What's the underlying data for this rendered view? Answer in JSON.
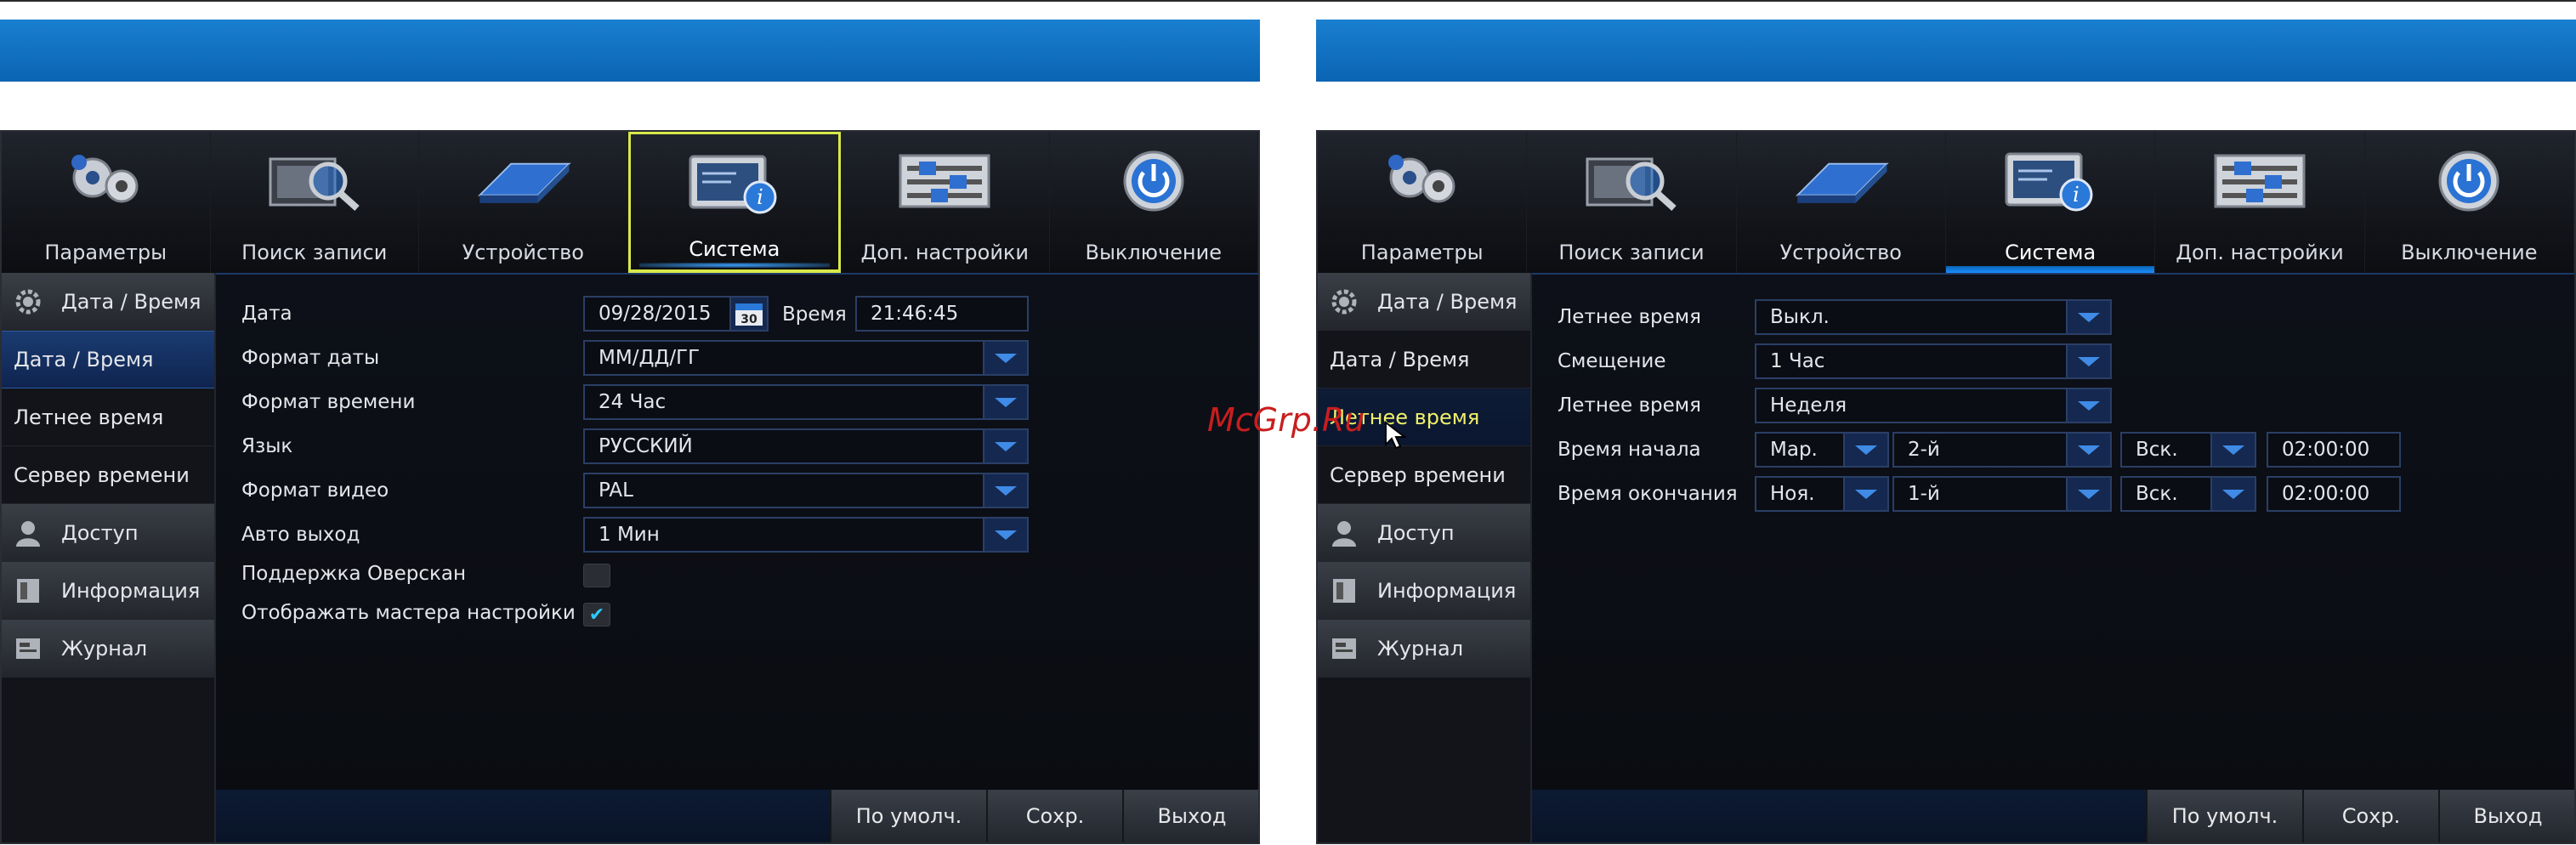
{
  "tabs": [
    "Параметры",
    "Поиск записи",
    "Устройство",
    "Система",
    "Доп. настройки",
    "Выключение"
  ],
  "sidebar": {
    "cat_datetime": "Дата / Время",
    "item_datetime": "Дата / Время",
    "item_dst": "Летнее время",
    "item_timeserver": "Сервер времени",
    "cat_access": "Доступ",
    "cat_info": "Информация",
    "cat_log": "Журнал"
  },
  "left_form": {
    "date_label": "Дата",
    "date_value": "09/28/2015",
    "calendar_day": "30",
    "time_label": "Время",
    "time_value": "21:46:45",
    "date_format_label": "Формат даты",
    "date_format_value": "ММ/ДД/ГГ",
    "time_format_label": "Формат времени",
    "time_format_value": "24 Час",
    "language_label": "Язык",
    "language_value": "РУССКИЙ",
    "video_format_label": "Формат видео",
    "video_format_value": "PAL",
    "auto_exit_label": "Авто выход",
    "auto_exit_value": "1 Мин",
    "overscan_label": "Поддержка Оверскан",
    "overscan_checked": false,
    "wizard_label": "Отображать мастера настройки",
    "wizard_checked": true
  },
  "right_form": {
    "dst_label": "Летнее время",
    "dst_value": "Выкл.",
    "offset_label": "Смещение",
    "offset_value": "1 Час",
    "dst_mode_label": "Летнее время",
    "dst_mode_value": "Неделя",
    "start_label": "Время начала",
    "start_month": "Мар.",
    "start_week": "2-й",
    "start_day": "Вск.",
    "start_time": "02:00:00",
    "end_label": "Время окончания",
    "end_month": "Ноя.",
    "end_week": "1-й",
    "end_day": "Вск.",
    "end_time": "02:00:00"
  },
  "buttons": {
    "default": "По умолч.",
    "save": "Сохр.",
    "exit": "Выход"
  },
  "watermark": "McGrp.Ru",
  "colors": {
    "band": "#0a64b3",
    "accent": "#3f8be6",
    "active_tab_border": "#d8e84a"
  }
}
